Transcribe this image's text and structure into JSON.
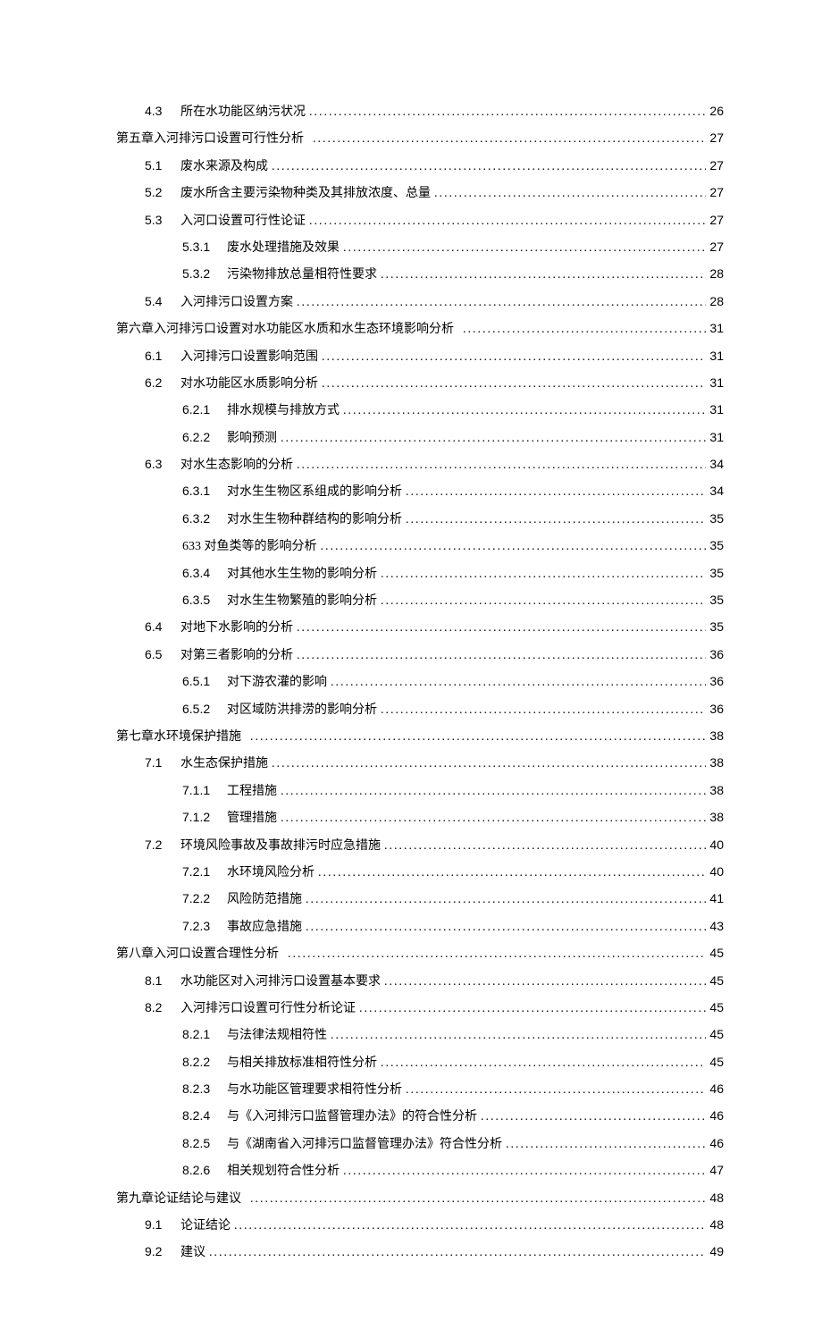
{
  "toc": [
    {
      "level": 2,
      "num": "4.3",
      "title": "所在水功能区纳污状况",
      "page": "26"
    },
    {
      "level": 1,
      "num": "第五章",
      "title": "入河排污口设置可行性分析",
      "page": "27"
    },
    {
      "level": 2,
      "num": "5.1",
      "title": "废水来源及构成",
      "page": "27"
    },
    {
      "level": 2,
      "num": "5.2",
      "title": "废水所含主要污染物种类及其排放浓度、总量",
      "page": "27"
    },
    {
      "level": 2,
      "num": "5.3",
      "title": "入河口设置可行性论证",
      "page": "27"
    },
    {
      "level": 3,
      "num": "5.3.1",
      "title": "废水处理措施及效果",
      "page": "27"
    },
    {
      "level": 3,
      "num": "5.3.2",
      "title": "污染物排放总量相符性要求",
      "page": "28"
    },
    {
      "level": 2,
      "num": "5.4",
      "title": "入河排污口设置方案",
      "page": "28"
    },
    {
      "level": 1,
      "num": "第六章",
      "title": "入河排污口设置对水功能区水质和水生态环境影响分析",
      "page": "31"
    },
    {
      "level": 2,
      "num": "6.1",
      "title": "入河排污口设置影响范围",
      "page": "31"
    },
    {
      "level": 2,
      "num": "6.2",
      "title": "对水功能区水质影响分析",
      "page": "31"
    },
    {
      "level": 3,
      "num": "6.2.1",
      "title": "排水规模与排放方式",
      "page": "31"
    },
    {
      "level": 3,
      "num": "6.2.2",
      "title": "影响预测",
      "page": "31"
    },
    {
      "level": 2,
      "num": "6.3",
      "title": "对水生态影响的分析",
      "page": "34"
    },
    {
      "level": 3,
      "num": "6.3.1",
      "title": "对水生生物区系组成的影响分析",
      "page": "34"
    },
    {
      "level": 3,
      "num": "6.3.2",
      "title": "对水生生物种群结构的影响分析",
      "page": "35"
    },
    {
      "level": 3,
      "num": "633",
      "title": "对鱼类等的影响分析",
      "page": "35",
      "nonum": true
    },
    {
      "level": 3,
      "num": "6.3.4",
      "title": "对其他水生生物的影响分析",
      "page": "35"
    },
    {
      "level": 3,
      "num": "6.3.5",
      "title": "对水生生物繁殖的影响分析",
      "page": "35"
    },
    {
      "level": 2,
      "num": "6.4",
      "title": "对地下水影响的分析",
      "page": "35"
    },
    {
      "level": 2,
      "num": "6.5",
      "title": "对第三者影响的分析",
      "page": "36"
    },
    {
      "level": 3,
      "num": "6.5.1",
      "title": "对下游农灌的影响",
      "page": "36"
    },
    {
      "level": 3,
      "num": "6.5.2",
      "title": "对区域防洪排涝的影响分析",
      "page": "36"
    },
    {
      "level": 1,
      "num": "第七章",
      "title": "水环境保护措施",
      "page": "38"
    },
    {
      "level": 2,
      "num": "7.1",
      "title": "水生态保护措施",
      "page": "38"
    },
    {
      "level": 3,
      "num": "7.1.1",
      "title": "工程措施",
      "page": "38"
    },
    {
      "level": 3,
      "num": "7.1.2",
      "title": "管理措施",
      "page": "38"
    },
    {
      "level": 2,
      "num": "7.2",
      "title": "环境风险事故及事故排污时应急措施",
      "page": "40"
    },
    {
      "level": 3,
      "num": "7.2.1",
      "title": "水环境风险分析",
      "page": "40"
    },
    {
      "level": 3,
      "num": "7.2.2",
      "title": "风险防范措施",
      "page": "41"
    },
    {
      "level": 3,
      "num": "7.2.3",
      "title": "事故应急措施",
      "page": "43"
    },
    {
      "level": 1,
      "num": "第八章",
      "title": "入河口设置合理性分析",
      "page": "45"
    },
    {
      "level": 2,
      "num": "8.1",
      "title": "水功能区对入河排污口设置基本要求",
      "page": "45"
    },
    {
      "level": 2,
      "num": "8.2",
      "title": "入河排污口设置可行性分析论证",
      "page": "45"
    },
    {
      "level": 3,
      "num": "8.2.1",
      "title": "与法律法规相符性",
      "page": "45"
    },
    {
      "level": 3,
      "num": "8.2.2",
      "title": "与相关排放标准相符性分析",
      "page": "45"
    },
    {
      "level": 3,
      "num": "8.2.3",
      "title": "与水功能区管理要求相符性分析",
      "page": "46"
    },
    {
      "level": 3,
      "num": "8.2.4",
      "title": "与《入河排污口监督管理办法》的符合性分析",
      "page": "46"
    },
    {
      "level": 3,
      "num": "8.2.5",
      "title": "与《湖南省入河排污口监督管理办法》符合性分析",
      "page": "46"
    },
    {
      "level": 3,
      "num": "8.2.6",
      "title": "相关规划符合性分析",
      "page": "47"
    },
    {
      "level": 1,
      "num": "第九章",
      "title": "论证结论与建议",
      "page": "48"
    },
    {
      "level": 2,
      "num": "9.1",
      "title": "论证结论",
      "page": "48"
    },
    {
      "level": 2,
      "num": "9.2",
      "title": "建议",
      "page": "49"
    }
  ]
}
